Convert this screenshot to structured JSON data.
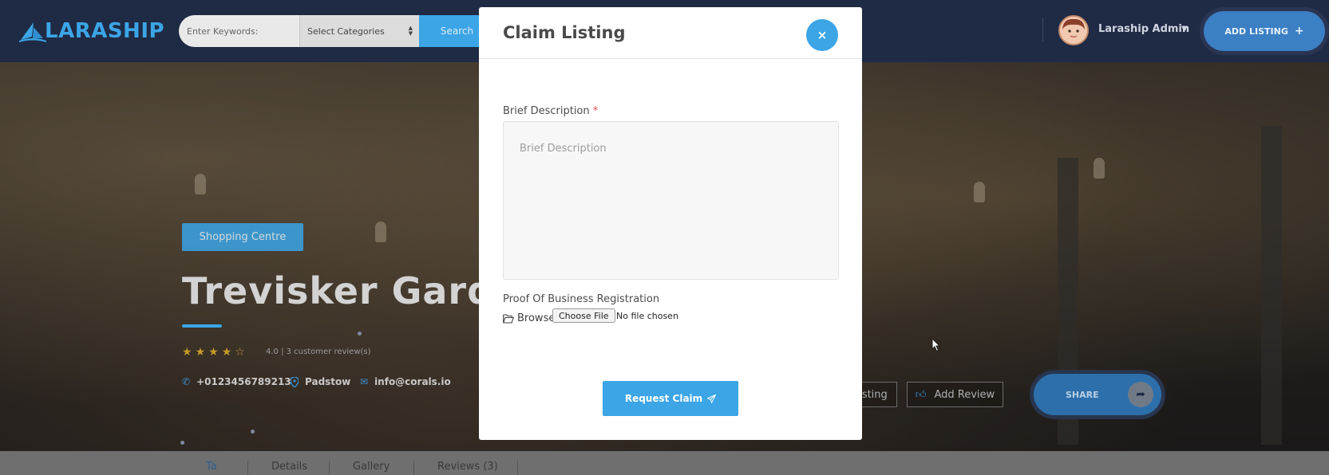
{
  "header": {
    "logo_text": "LARASHIP",
    "keywords_placeholder": "Enter Keywords:",
    "category_select": "Select Categories",
    "search_label": "Search",
    "user_name": "Laraship Admin",
    "add_listing_label": "ADD LISTING"
  },
  "hero": {
    "category_tag": "Shopping Centre",
    "title": "Trevisker Garden",
    "rating": 4,
    "rating_text": "4.0 | 3 customer review(s)",
    "phone": "+0123456789213",
    "location": "Padstow",
    "email": "info@corals.io",
    "claim_listing_partial": "isting",
    "add_review_label": "Add Review",
    "share_label": "SHARE"
  },
  "tabs": [
    "Ta",
    "Details",
    "Gallery",
    "Reviews (3)"
  ],
  "modal": {
    "title": "Claim Listing",
    "close_symbol": "×",
    "description_label": "Brief Description",
    "required_mark": "*",
    "description_placeholder": "Brief Description",
    "proof_label": "Proof Of Business Registration",
    "browse_label": "Browse",
    "choose_file_label": "Choose File",
    "no_file_text": "No file chosen",
    "request_button_label": "Request Claim"
  },
  "colors": {
    "accent": "#3ba5e6",
    "header_bg": "#1f2a44",
    "star": "#c69a2a"
  },
  "icons": {
    "phone": "phone-icon",
    "location": "map-pin-icon",
    "email": "envelope-icon",
    "folder": "folder-open-icon",
    "send": "paper-plane-icon",
    "share": "share-arrow-icon",
    "thumbs_up": "thumbs-up-icon"
  }
}
